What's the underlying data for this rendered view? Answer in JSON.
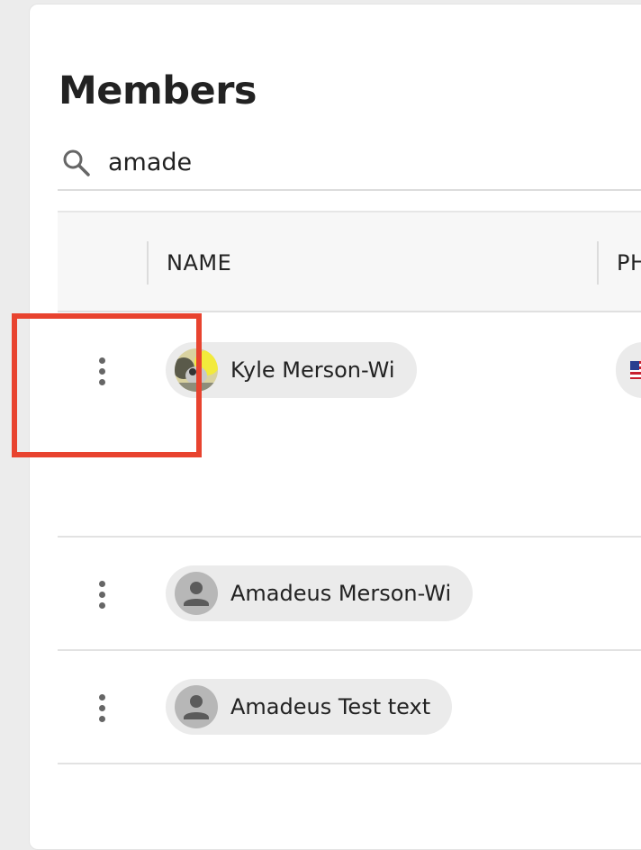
{
  "page": {
    "title": "Members"
  },
  "search": {
    "value": "amade",
    "icon": "search-icon"
  },
  "table": {
    "columns": [
      "NAME",
      "PH"
    ],
    "rows": [
      {
        "name": "Kyle Merson-Wi",
        "avatar": "photo",
        "phone_flag": "US"
      },
      {
        "name": "Amadeus Merson-Wi",
        "avatar": "person-icon"
      },
      {
        "name": "Amadeus Test text",
        "avatar": "person-icon"
      }
    ]
  },
  "colors": {
    "highlight": "#e8432f",
    "chip_bg": "#ebebeb",
    "header_bg": "#f7f7f7"
  }
}
